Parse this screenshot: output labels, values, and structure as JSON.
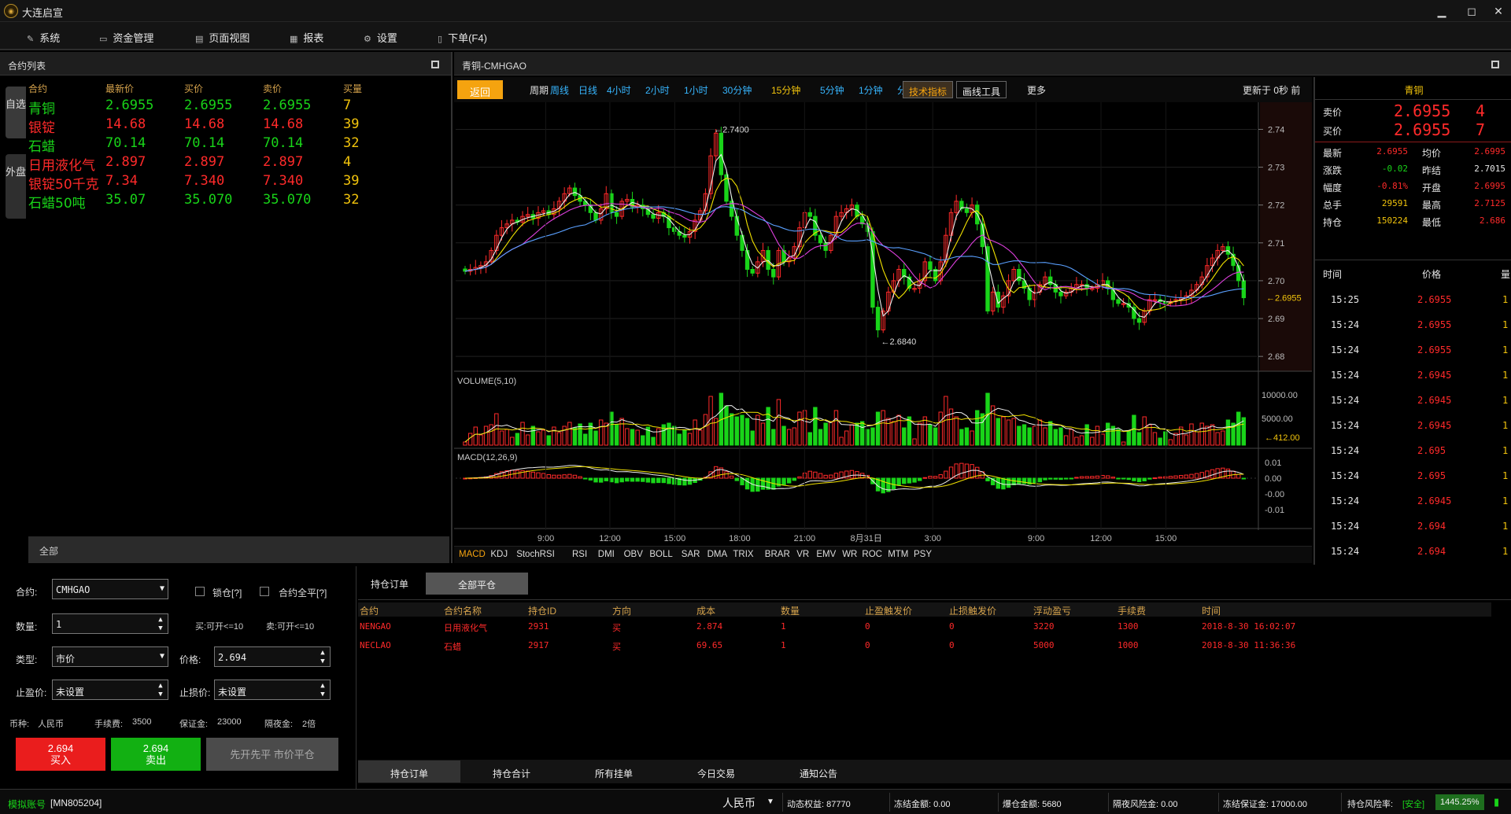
{
  "app": {
    "title": "大连启宣"
  },
  "menu": [
    {
      "label": "系统",
      "icon": "gear-icon"
    },
    {
      "label": "资金管理",
      "icon": "wallet-icon"
    },
    {
      "label": "页面视图",
      "icon": "monitor-icon"
    },
    {
      "label": "报表",
      "icon": "report-icon"
    },
    {
      "label": "设置",
      "icon": "tools-icon"
    },
    {
      "label": "下单(F4)",
      "icon": "document-icon"
    }
  ],
  "contract_list": {
    "title": "合约列表",
    "side_tabs": [
      "自选",
      "外盘"
    ],
    "columns": [
      "合约",
      "最新价",
      "买价",
      "卖价",
      "买量"
    ],
    "rows": [
      {
        "name": "青铜",
        "last": "2.6955",
        "bid": "2.6955",
        "ask": "2.6955",
        "vol": "7",
        "dir": "dn"
      },
      {
        "name": "银锭",
        "last": "14.68",
        "bid": "14.68",
        "ask": "14.68",
        "vol": "39",
        "dir": "up"
      },
      {
        "name": "石蜡",
        "last": "70.14",
        "bid": "70.14",
        "ask": "70.14",
        "vol": "32",
        "dir": "dn"
      },
      {
        "name": "日用液化气",
        "last": "2.897",
        "bid": "2.897",
        "ask": "2.897",
        "vol": "4",
        "dir": "up"
      },
      {
        "name": "银锭50千克",
        "last": "7.34",
        "bid": "7.340",
        "ask": "7.340",
        "vol": "39",
        "dir": "up"
      },
      {
        "name": "石蜡50吨",
        "last": "35.07",
        "bid": "35.070",
        "ask": "35.070",
        "vol": "32",
        "dir": "dn"
      }
    ],
    "footer": "全部"
  },
  "chart_panel": {
    "title": "青铜-CMHGAO",
    "back": "返回",
    "period_label": "周期",
    "periods": [
      "周线",
      "日线",
      "4小时",
      "2小时",
      "1小时",
      "30分钟",
      "15分钟",
      "5分钟",
      "1分钟",
      "分时"
    ],
    "active_period": "15分钟",
    "tech_btn": "技术指标",
    "draw_btn": "画线工具",
    "more": "更多",
    "updated": "更新于 0秒 前"
  },
  "chart_data": {
    "type": "candlestick",
    "price_ticks": [
      "2.74",
      "2.73",
      "2.72",
      "2.71",
      "2.70",
      "2.69",
      "2.68"
    ],
    "price_range": [
      2.6765,
      2.7455
    ],
    "high_label": "2.7400",
    "low_label": "2.6840",
    "last_label": "2.6955",
    "volume_title": "VOLUME(5,10)",
    "volume_ticks": [
      "10000.00",
      "5000.00"
    ],
    "volume_last": "412.00",
    "macd_title": "MACD(12,26,9)",
    "macd_ticks": [
      "0.01",
      "0.00",
      "-0.00",
      "-0.01"
    ],
    "time_ticks": [
      "9:00",
      "12:00",
      "15:00",
      "18:00",
      "21:00",
      "8月31日",
      "3:00",
      "9:00",
      "12:00",
      "15:00"
    ],
    "closes": [
      2.7025,
      2.703,
      2.7035,
      2.704,
      2.705,
      2.708,
      2.712,
      2.714,
      2.715,
      2.716,
      2.7155,
      2.717,
      2.7175,
      2.7165,
      2.718,
      2.7185,
      2.7175,
      2.719,
      2.721,
      2.723,
      2.7245,
      2.7225,
      2.721,
      2.72,
      2.718,
      2.716,
      2.719,
      2.723,
      2.718,
      2.717,
      2.721,
      2.7215,
      2.7195,
      2.72,
      2.719,
      2.7175,
      2.7165,
      2.718,
      2.717,
      2.714,
      2.713,
      2.712,
      2.7115,
      2.713,
      2.716,
      2.7185,
      2.723,
      2.733,
      2.739,
      2.728,
      2.721,
      2.717,
      2.712,
      2.708,
      2.703,
      2.702,
      2.705,
      2.708,
      2.703,
      2.701,
      2.708,
      2.705,
      2.706,
      2.709,
      2.714,
      2.718,
      2.717,
      2.712,
      2.71,
      2.708,
      2.712,
      2.717,
      2.718,
      2.719,
      2.72,
      2.717,
      2.715,
      2.713,
      2.693,
      2.687,
      2.692,
      2.697,
      2.7,
      2.703,
      2.701,
      2.698,
      2.698,
      2.7,
      2.705,
      2.703,
      2.7,
      2.705,
      2.712,
      2.718,
      2.721,
      2.719,
      2.718,
      2.72,
      2.715,
      2.709,
      2.692,
      2.697,
      2.693,
      2.696,
      2.7,
      2.703,
      2.7,
      2.698,
      2.695,
      2.697,
      2.699,
      2.701,
      2.699,
      2.697,
      2.696,
      2.697,
      2.698,
      2.699,
      2.699,
      2.698,
      2.698,
      2.699,
      2.7,
      2.698,
      2.695,
      2.694,
      2.694,
      2.693,
      2.69,
      2.689,
      2.692,
      2.695,
      2.695,
      2.6945,
      2.694,
      2.6945,
      2.695,
      2.6955,
      2.696,
      2.6975,
      2.699,
      2.701,
      2.704,
      2.706,
      2.708,
      2.709,
      2.707,
      2.704,
      2.7,
      2.6955
    ]
  },
  "indicators": [
    "MACD",
    "KDJ",
    "StochRSI",
    "RSI",
    "DMI",
    "OBV",
    "BOLL",
    "SAR",
    "DMA",
    "TRIX",
    "BRAR",
    "VR",
    "EMV",
    "WR",
    "ROC",
    "MTM",
    "PSY"
  ],
  "quote": {
    "name": "青铜",
    "ask_label": "卖价",
    "ask": "2.6955",
    "ask_vol": "4",
    "bid_label": "买价",
    "bid": "2.6955",
    "bid_vol": "7",
    "stats": [
      {
        "l1": "最新",
        "v1": "2.6955",
        "c1": "up",
        "l2": "均价",
        "v2": "2.6995",
        "c2": "up"
      },
      {
        "l1": "涨跌",
        "v1": "-0.02",
        "c1": "dn",
        "l2": "昨结",
        "v2": "2.7015",
        "c2": "wht"
      },
      {
        "l1": "幅度",
        "v1": "-0.81%",
        "c1": "up",
        "l2": "开盘",
        "v2": "2.6995",
        "c2": "up"
      },
      {
        "l1": "总手",
        "v1": "29591",
        "c1": "yel",
        "l2": "最高",
        "v2": "2.7125",
        "c2": "up"
      },
      {
        "l1": "持仓",
        "v1": "150224",
        "c1": "yel",
        "l2": "最低",
        "v2": "2.686",
        "c2": "up"
      }
    ],
    "tick_headers": [
      "时间",
      "价格",
      "量"
    ],
    "ticks": [
      {
        "t": "15:25",
        "p": "2.6955",
        "q": "1"
      },
      {
        "t": "15:24",
        "p": "2.6955",
        "q": "1"
      },
      {
        "t": "15:24",
        "p": "2.6955",
        "q": "1"
      },
      {
        "t": "15:24",
        "p": "2.6945",
        "q": "1"
      },
      {
        "t": "15:24",
        "p": "2.6945",
        "q": "1"
      },
      {
        "t": "15:24",
        "p": "2.6945",
        "q": "1"
      },
      {
        "t": "15:24",
        "p": "2.695",
        "q": "1"
      },
      {
        "t": "15:24",
        "p": "2.695",
        "q": "1"
      },
      {
        "t": "15:24",
        "p": "2.6945",
        "q": "1"
      },
      {
        "t": "15:24",
        "p": "2.694",
        "q": "1"
      },
      {
        "t": "15:24",
        "p": "2.694",
        "q": "1"
      }
    ]
  },
  "order": {
    "contract_label": "合约:",
    "contract": "CMHGAO",
    "lock_label": "锁仓[?]",
    "closeall_label": "合约全平[?]",
    "qty_label": "数量:",
    "qty": "1",
    "buy_avail": "买:可开<=10",
    "sell_avail": "卖:可开<=10",
    "type_label": "类型:",
    "type": "市价",
    "price_label": "价格:",
    "price": "2.694",
    "tp_label": "止盈价:",
    "tp": "未设置",
    "sl_label": "止损价:",
    "sl": "未设置",
    "info": {
      "currency_label": "币种:",
      "currency": "人民币",
      "fee_label": "手续费:",
      "fee": "3500",
      "margin_label": "保证金:",
      "margin": "23000",
      "overnight_label": "隔夜金:",
      "overnight": "2倍"
    },
    "buy_price": "2.694",
    "buy_label": "买入",
    "sell_price": "2.694",
    "sell_label": "卖出",
    "close_label": "先开先平  市价平仓"
  },
  "positions": {
    "tab": "持仓订单",
    "close_all": "全部平仓",
    "columns": [
      "合约",
      "合约名称",
      "持仓ID",
      "方向",
      "成本",
      "数量",
      "止盈触发价",
      "止损触发价",
      "浮动盈亏",
      "手续费",
      "时间"
    ],
    "rows": [
      [
        "NENGAO",
        "日用液化气",
        "2931",
        "买",
        "2.874",
        "1",
        "0",
        "0",
        "3220",
        "1300",
        "2018-8-30 16:02:07"
      ],
      [
        "NECLAO",
        "石蜡",
        "2917",
        "买",
        "69.65",
        "1",
        "0",
        "0",
        "5000",
        "1000",
        "2018-8-30 11:36:36"
      ]
    ],
    "bottom_tabs": [
      "持仓订单",
      "持仓合计",
      "所有挂单",
      "今日交易",
      "通知公告"
    ]
  },
  "status": {
    "account_label": "模拟账号",
    "account": "[MN805204]",
    "currency": "人民币",
    "equity": "动态权益: 87770",
    "frozen": "冻结金额: 0.00",
    "liquidation": "爆仓金额: 5680",
    "overnight_risk": "隔夜风险金: 0.00",
    "frozen_margin": "冻结保证金: 17000.00",
    "risk_label": "持仓风险率:",
    "risk_state": "[安全]",
    "risk_value": "1445.25%"
  }
}
